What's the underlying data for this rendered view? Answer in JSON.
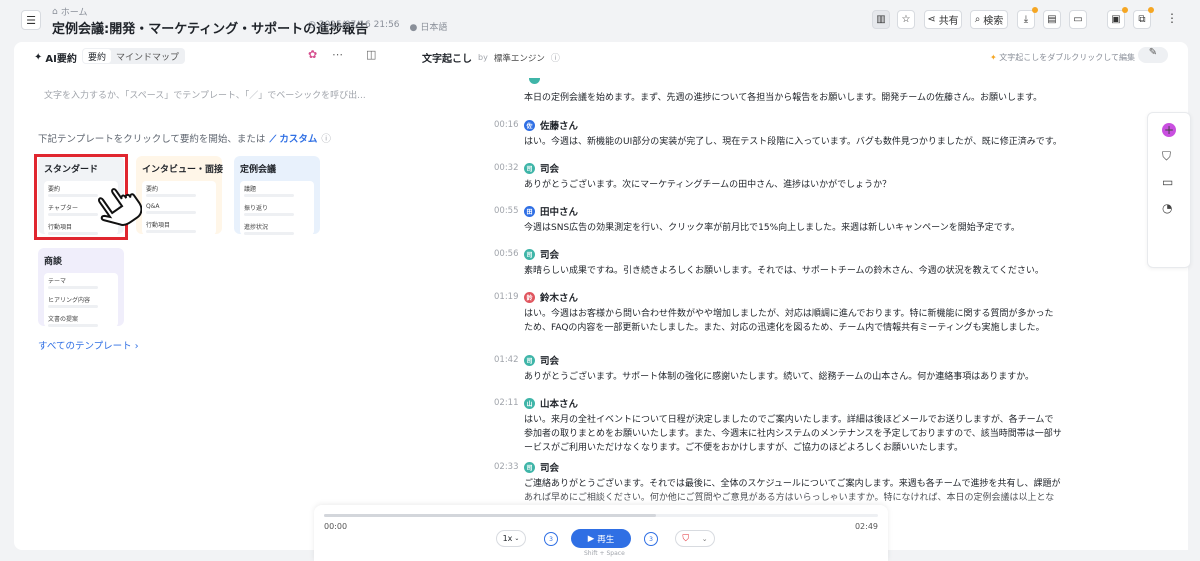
{
  "header": {
    "home_label": "ホーム",
    "title": "定例会議:開発・マーケティング・サポートの進捗報告",
    "datetime": "2025/07/16 21:56",
    "language": "日本語",
    "share_label": "共有",
    "search_label": "検索"
  },
  "summary": {
    "title": "AI要約",
    "tab_summary": "要約",
    "tab_mindmap": "マインドマップ",
    "input_placeholder": "文字を入力するか、「スペース」でテンプレート、「／」でベーシックを呼び出...",
    "hint": "下記テンプレートをクリックして要約を開始、または",
    "custom_label": "カスタム",
    "all_templates": "すべてのテンプレート ›",
    "templates": [
      {
        "title": "スタンダード",
        "items": [
          "要約",
          "チャプター",
          "行動項目"
        ]
      },
      {
        "title": "インタビュー・面接",
        "items": [
          "要約",
          "Q&A",
          "行動項目"
        ]
      },
      {
        "title": "定例会議",
        "items": [
          "議題",
          "振り返り",
          "進捗状況"
        ]
      },
      {
        "title": "商談",
        "items": [
          "テーマ",
          "ヒアリング内容",
          "文書の提案"
        ]
      }
    ]
  },
  "transcript": {
    "title": "文字起こし",
    "by": "by",
    "engine": "標準エンジン",
    "tip": "文字起こしをダブルクリックして編集",
    "entries": [
      {
        "time": "",
        "speaker": "",
        "avatar": "",
        "text": "本日の定例会議を始めます。まず、先週の進捗について各担当から報告をお願いします。開発チームの佐藤さん。お願いします。"
      },
      {
        "time": "00:16",
        "speaker": "佐藤さん",
        "avatar": "佐",
        "text": "はい。今週は、新機能のUI部分の実装が完了し、現在テスト段階に入っています。バグも数件見つかりましたが、既に修正済みです。"
      },
      {
        "time": "00:32",
        "speaker": "司会",
        "avatar": "司",
        "text": "ありがとうございます。次にマーケティングチームの田中さん、進捗はいかがでしょうか？"
      },
      {
        "time": "00:55",
        "speaker": "田中さん",
        "avatar": "田",
        "text": "今週はSNS広告の効果測定を行い、クリック率が前月比で15%向上しました。来週は新しいキャンペーンを開始予定です。"
      },
      {
        "time": "00:56",
        "speaker": "司会",
        "avatar": "司",
        "text": "素晴らしい成果ですね。引き続きよろしくお願いします。それでは、サポートチームの鈴木さん、今週の状況を教えてください。"
      },
      {
        "time": "01:19",
        "speaker": "鈴木さん",
        "avatar": "鈴",
        "text": "はい。今週はお客様から問い合わせ件数がやや増加しましたが、対応は順調に進んでおります。特に新機能に関する質問が多かったため、FAQの内容を一部更新いたしました。また、対応の迅速化を図るため、チーム内で情報共有ミーティングも実施しました。"
      },
      {
        "time": "01:42",
        "speaker": "司会",
        "avatar": "司",
        "text": "ありがとうございます。サポート体制の強化に感謝いたします。続いて、総務チームの山本さん。何か連絡事項はありますか。"
      },
      {
        "time": "02:11",
        "speaker": "山本さん",
        "avatar": "山",
        "text": "はい。来月の全社イベントについて日程が決定しましたのでご案内いたします。詳細は後ほどメールでお送りしますが、各チームで参加者の取りまとめをお願いいたします。また、今週末に社内システムのメンテナンスを予定しておりますので、該当時間帯は一部サービスがご利用いただけなくなります。ご不便をおかけしますが、ご協力のほどよろしくお願いいたします。"
      },
      {
        "time": "02:33",
        "speaker": "司会",
        "avatar": "司",
        "text": "ご連絡ありがとうございます。それでは最後に、全体のスケジュールについてご案内します。来週も各チームで進捗を共有し、課題があれば早めにご相談ください。何か他にご質問やご意見がある方はいらっしゃいますか。特になければ、本日の定例会議は以上となりま"
      }
    ]
  },
  "player": {
    "current": "00:00",
    "duration": "02:49",
    "progress": 0.6,
    "speed": "1x",
    "skip_back": "3",
    "skip_forward": "3",
    "play_label": "再生",
    "shortcut": "Shift + Space"
  },
  "colors": {
    "accent": "#2f6fe4",
    "highlight": "#e0262f",
    "avatar_sato": "#2f6fe4",
    "avatar_host": "#3fb5a8",
    "avatar_tanaka": "#2f6fe4",
    "avatar_suzuki": "#e0565f",
    "avatar_yamamoto": "#3fb5a8"
  }
}
